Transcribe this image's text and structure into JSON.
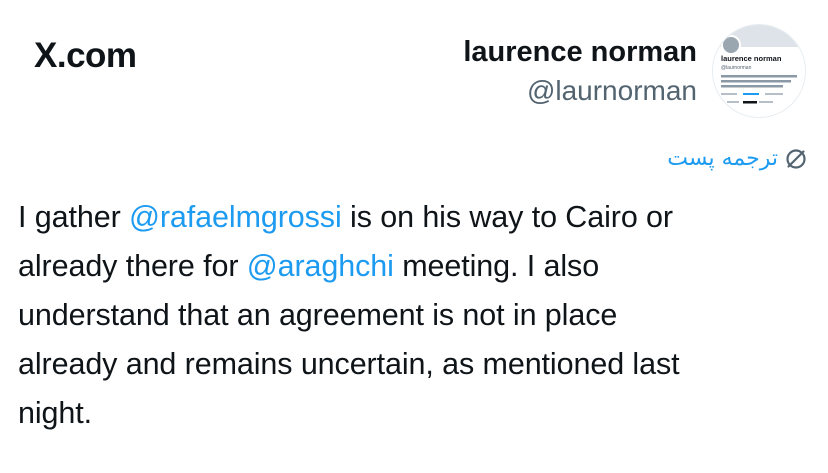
{
  "site": {
    "logo": "X.com"
  },
  "author": {
    "name": "laurence norman",
    "handle": "@laurnorman",
    "avatar_card": {
      "name": "laurence norman",
      "handle": "@laurnorman",
      "bio": "In Europe for The Wall Street Journal. nuclear, EU, European foreign policy that comes my way. My RT, screens"
    }
  },
  "translate": {
    "label": "ترجمه پست",
    "icon": "globe-translate-icon"
  },
  "tweet": {
    "lines": [
      [
        "I gather ",
        "@rafaelmgrossi",
        " is on his way to Cairo or"
      ],
      [
        "already there for ",
        "@araghchi",
        " meeting. I also"
      ],
      [
        "understand that an agreement is not in place"
      ],
      [
        "already and remains uncertain, as mentioned last"
      ],
      [
        "night."
      ]
    ]
  },
  "colors": {
    "text": "#0f1419",
    "secondary": "#536471",
    "accent": "#1d9bf0"
  }
}
